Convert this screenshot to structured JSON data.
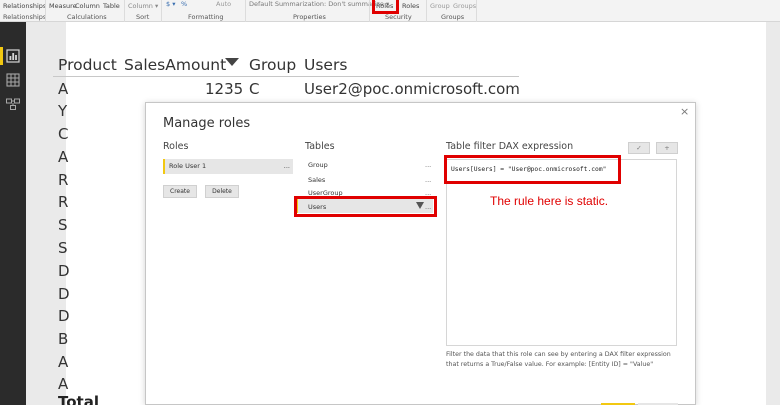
{
  "ribbon": {
    "relationships_btn": "Relationships",
    "measure_btn": "Measure",
    "column_btn": "Column",
    "table_btn": "Table",
    "sort_column_btn": "Column ▾",
    "format_currency": "$ ▾",
    "format_percent": "%",
    "format_auto": "Auto",
    "summarization": "Default Summarization: Don't summarize ▾",
    "roles_btn": "Roles",
    "view_roles_btn": "Roles",
    "group_btn": "Group",
    "groups_btn": "Groups",
    "labels": {
      "relationships": "Relationships",
      "calculations": "Calculations",
      "sort": "Sort",
      "formatting": "Formatting",
      "properties": "Properties",
      "security": "Security",
      "groups": "Groups"
    }
  },
  "report": {
    "headers": [
      "Product",
      "SalesAmount",
      "Group",
      "Users"
    ],
    "first_row": {
      "product": "A",
      "sales": "1235",
      "group": "C",
      "user": "User2@poc.onmicrosoft.com"
    },
    "products": [
      "Y",
      "C",
      "A",
      "R",
      "R",
      "S",
      "S",
      "D",
      "D",
      "D",
      "B",
      "A",
      "A"
    ],
    "total_label": "Total"
  },
  "dialog": {
    "title": "Manage roles",
    "close": "×",
    "roles_label": "Roles",
    "role_item": "Role User 1",
    "ellipsis": "...",
    "create_btn": "Create",
    "delete_btn": "Delete",
    "tables_label": "Tables",
    "tables": [
      "Group",
      "Sales",
      "UserGroup",
      "Users"
    ],
    "expr_label": "Table filter DAX expression",
    "check_btn": "✓",
    "add_btn": "+",
    "expression": "Users[Users] = \"User@poc.onmicrosoft.com\"",
    "annotation": "The rule here is static.",
    "help_text": "Filter the data that this role can see by entering a DAX filter expression that returns a True/False value. For example: [Entity ID] = \"Value\""
  },
  "colors": {
    "accent": "#f2c811",
    "highlight": "#e00000",
    "nav_bg": "#2b2b2b"
  }
}
